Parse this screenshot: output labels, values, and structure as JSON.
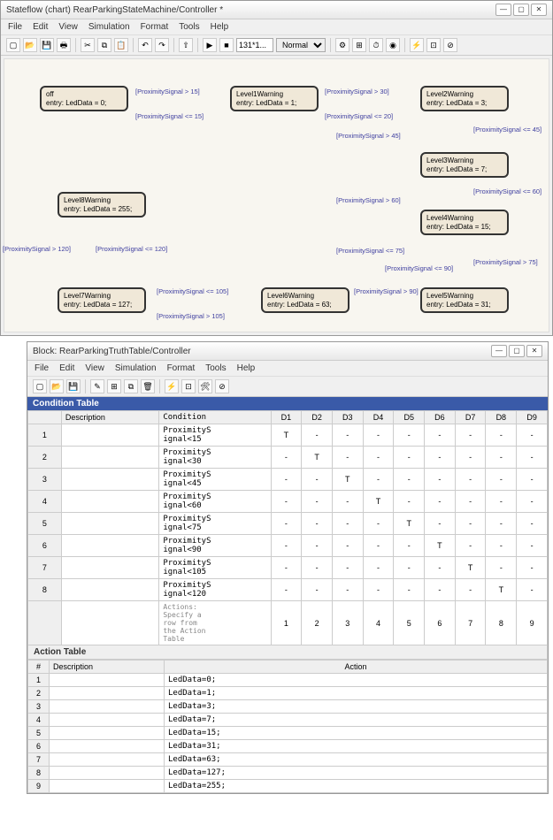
{
  "win1": {
    "title": "Stateflow (chart) RearParkingStateMachine/Controller *",
    "menu": [
      "File",
      "Edit",
      "View",
      "Simulation",
      "Format",
      "Tools",
      "Help"
    ],
    "toolbar": {
      "time_input": "131*1...",
      "mode_select": "Normal"
    },
    "states": {
      "off": {
        "name": "off",
        "entry": "entry: LedData = 0;"
      },
      "l1": {
        "name": "Level1Warning",
        "entry": "entry: LedData = 1;"
      },
      "l2": {
        "name": "Level2Warning",
        "entry": "entry: LedData = 3;"
      },
      "l3": {
        "name": "Level3Warning",
        "entry": "entry: LedData = 7;"
      },
      "l4": {
        "name": "Level4Warning",
        "entry": "entry: LedData = 15;"
      },
      "l5": {
        "name": "Level5Warning",
        "entry": "entry: LedData = 31;"
      },
      "l6": {
        "name": "Level6Warning",
        "entry": "entry: LedData = 63;"
      },
      "l7": {
        "name": "Level7Warning",
        "entry": "entry: LedData = 127;"
      },
      "l8": {
        "name": "Level8Warning",
        "entry": "entry: LedData = 255;"
      }
    },
    "trans": {
      "t1": "[ProximitySignal > 15]",
      "t2": "[ProximitySignal <= 15]",
      "t3": "[ProximitySignal > 30]",
      "t4": "[ProximitySignal <= 20]",
      "t5": "[ProximitySignal > 45]",
      "t6": "[ProximitySignal <= 45]",
      "t7": "[ProximitySignal > 60]",
      "t8": "[ProximitySignal <= 60]",
      "t9": "[ProximitySignal > 75]",
      "t10": "[ProximitySignal <= 75]",
      "t11": "[ProximitySignal > 90]",
      "t12": "[ProximitySignal <= 90]",
      "t13": "[ProximitySignal > 105]",
      "t14": "[ProximitySignal <= 105]",
      "t15": "[ProximitySignal > 120]",
      "t16": "[ProximitySignal <= 120]"
    }
  },
  "win2": {
    "title": "Block: RearParkingTruthTable/Controller",
    "menu": [
      "File",
      "Edit",
      "View",
      "Simulation",
      "Format",
      "Tools",
      "Help"
    ],
    "cond_header": "Condition Table",
    "act_header": "Action Table",
    "cols": {
      "desc": "Description",
      "cond": "Condition",
      "d": [
        "D1",
        "D2",
        "D3",
        "D4",
        "D5",
        "D6",
        "D7",
        "D8",
        "D9"
      ]
    },
    "rows": [
      {
        "n": "1",
        "cond": "ProximityS\nignal<15",
        "d": [
          "T",
          "-",
          "-",
          "-",
          "-",
          "-",
          "-",
          "-",
          "-"
        ]
      },
      {
        "n": "2",
        "cond": "ProximityS\nignal<30",
        "d": [
          "-",
          "T",
          "-",
          "-",
          "-",
          "-",
          "-",
          "-",
          "-"
        ]
      },
      {
        "n": "3",
        "cond": "ProximityS\nignal<45",
        "d": [
          "-",
          "-",
          "T",
          "-",
          "-",
          "-",
          "-",
          "-",
          "-"
        ]
      },
      {
        "n": "4",
        "cond": "ProximityS\nignal<60",
        "d": [
          "-",
          "-",
          "-",
          "T",
          "-",
          "-",
          "-",
          "-",
          "-"
        ]
      },
      {
        "n": "5",
        "cond": "ProximityS\nignal<75",
        "d": [
          "-",
          "-",
          "-",
          "-",
          "T",
          "-",
          "-",
          "-",
          "-"
        ]
      },
      {
        "n": "6",
        "cond": "ProximityS\nignal<90",
        "d": [
          "-",
          "-",
          "-",
          "-",
          "-",
          "T",
          "-",
          "-",
          "-"
        ]
      },
      {
        "n": "7",
        "cond": "ProximityS\nignal<105",
        "d": [
          "-",
          "-",
          "-",
          "-",
          "-",
          "-",
          "T",
          "-",
          "-"
        ]
      },
      {
        "n": "8",
        "cond": "ProximityS\nignal<120",
        "d": [
          "-",
          "-",
          "-",
          "-",
          "-",
          "-",
          "-",
          "T",
          "-"
        ]
      }
    ],
    "actions_row_label": "Actions:\nSpecify a\nrow from\nthe Action\nTable",
    "action_nums": [
      "1",
      "2",
      "3",
      "4",
      "5",
      "6",
      "7",
      "8",
      "9"
    ],
    "act_cols": {
      "n": "#",
      "desc": "Description",
      "action": "Action"
    },
    "act_rows": [
      {
        "n": "1",
        "a": "LedData=0;"
      },
      {
        "n": "2",
        "a": "LedData=1;"
      },
      {
        "n": "3",
        "a": "LedData=3;"
      },
      {
        "n": "4",
        "a": "LedData=7;"
      },
      {
        "n": "5",
        "a": "LedData=15;"
      },
      {
        "n": "6",
        "a": "LedData=31;"
      },
      {
        "n": "7",
        "a": "LedData=63;"
      },
      {
        "n": "8",
        "a": "LedData=127;"
      },
      {
        "n": "9",
        "a": "LedData=255;"
      }
    ]
  }
}
